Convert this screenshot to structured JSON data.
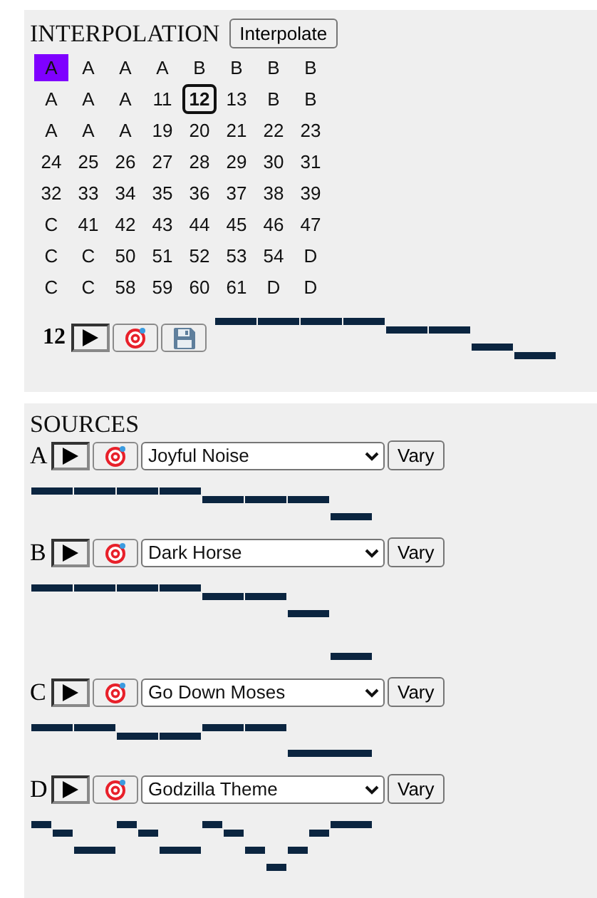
{
  "interpolation": {
    "title": "INTERPOLATION",
    "button": "Interpolate",
    "current": "12",
    "grid": [
      [
        {
          "label": "A",
          "selected": false,
          "highlighted": true
        },
        {
          "label": "A",
          "selected": false,
          "highlighted": false
        },
        {
          "label": "A",
          "selected": false,
          "highlighted": false
        },
        {
          "label": "A",
          "selected": false,
          "highlighted": false
        },
        {
          "label": "B",
          "selected": false,
          "highlighted": false
        },
        {
          "label": "B",
          "selected": false,
          "highlighted": false
        },
        {
          "label": "B",
          "selected": false,
          "highlighted": false
        },
        {
          "label": "B",
          "selected": false,
          "highlighted": false
        }
      ],
      [
        {
          "label": "A",
          "selected": false,
          "highlighted": false
        },
        {
          "label": "A",
          "selected": false,
          "highlighted": false
        },
        {
          "label": "A",
          "selected": false,
          "highlighted": false
        },
        {
          "label": "11",
          "selected": false,
          "highlighted": false
        },
        {
          "label": "12",
          "selected": true,
          "highlighted": false
        },
        {
          "label": "13",
          "selected": false,
          "highlighted": false
        },
        {
          "label": "B",
          "selected": false,
          "highlighted": false
        },
        {
          "label": "B",
          "selected": false,
          "highlighted": false
        }
      ],
      [
        {
          "label": "A",
          "selected": false,
          "highlighted": false
        },
        {
          "label": "A",
          "selected": false,
          "highlighted": false
        },
        {
          "label": "A",
          "selected": false,
          "highlighted": false
        },
        {
          "label": "19",
          "selected": false,
          "highlighted": false
        },
        {
          "label": "20",
          "selected": false,
          "highlighted": false
        },
        {
          "label": "21",
          "selected": false,
          "highlighted": false
        },
        {
          "label": "22",
          "selected": false,
          "highlighted": false
        },
        {
          "label": "23",
          "selected": false,
          "highlighted": false
        }
      ],
      [
        {
          "label": "24",
          "selected": false,
          "highlighted": false
        },
        {
          "label": "25",
          "selected": false,
          "highlighted": false
        },
        {
          "label": "26",
          "selected": false,
          "highlighted": false
        },
        {
          "label": "27",
          "selected": false,
          "highlighted": false
        },
        {
          "label": "28",
          "selected": false,
          "highlighted": false
        },
        {
          "label": "29",
          "selected": false,
          "highlighted": false
        },
        {
          "label": "30",
          "selected": false,
          "highlighted": false
        },
        {
          "label": "31",
          "selected": false,
          "highlighted": false
        }
      ],
      [
        {
          "label": "32",
          "selected": false,
          "highlighted": false
        },
        {
          "label": "33",
          "selected": false,
          "highlighted": false
        },
        {
          "label": "34",
          "selected": false,
          "highlighted": false
        },
        {
          "label": "35",
          "selected": false,
          "highlighted": false
        },
        {
          "label": "36",
          "selected": false,
          "highlighted": false
        },
        {
          "label": "37",
          "selected": false,
          "highlighted": false
        },
        {
          "label": "38",
          "selected": false,
          "highlighted": false
        },
        {
          "label": "39",
          "selected": false,
          "highlighted": false
        }
      ],
      [
        {
          "label": "C",
          "selected": false,
          "highlighted": false
        },
        {
          "label": "41",
          "selected": false,
          "highlighted": false
        },
        {
          "label": "42",
          "selected": false,
          "highlighted": false
        },
        {
          "label": "43",
          "selected": false,
          "highlighted": false
        },
        {
          "label": "44",
          "selected": false,
          "highlighted": false
        },
        {
          "label": "45",
          "selected": false,
          "highlighted": false
        },
        {
          "label": "46",
          "selected": false,
          "highlighted": false
        },
        {
          "label": "47",
          "selected": false,
          "highlighted": false
        }
      ],
      [
        {
          "label": "C",
          "selected": false,
          "highlighted": false
        },
        {
          "label": "C",
          "selected": false,
          "highlighted": false
        },
        {
          "label": "50",
          "selected": false,
          "highlighted": false
        },
        {
          "label": "51",
          "selected": false,
          "highlighted": false
        },
        {
          "label": "52",
          "selected": false,
          "highlighted": false
        },
        {
          "label": "53",
          "selected": false,
          "highlighted": false
        },
        {
          "label": "54",
          "selected": false,
          "highlighted": false
        },
        {
          "label": "D",
          "selected": false,
          "highlighted": false
        }
      ],
      [
        {
          "label": "C",
          "selected": false,
          "highlighted": false
        },
        {
          "label": "C",
          "selected": false,
          "highlighted": false
        },
        {
          "label": "58",
          "selected": false,
          "highlighted": false
        },
        {
          "label": "59",
          "selected": false,
          "highlighted": false
        },
        {
          "label": "60",
          "selected": false,
          "highlighted": false
        },
        {
          "label": "61",
          "selected": false,
          "highlighted": false
        },
        {
          "label": "D",
          "selected": false,
          "highlighted": false
        },
        {
          "label": "D",
          "selected": false,
          "highlighted": false
        }
      ]
    ]
  },
  "sources": {
    "title": "SOURCES",
    "items": [
      {
        "letter": "A",
        "song": "Joyful Noise",
        "button": "Vary"
      },
      {
        "letter": "B",
        "song": "Dark Horse",
        "button": "Vary"
      },
      {
        "letter": "C",
        "song": "Go Down Moses",
        "button": "Vary"
      },
      {
        "letter": "D",
        "song": "Godzilla Theme",
        "button": "Vary"
      }
    ]
  }
}
